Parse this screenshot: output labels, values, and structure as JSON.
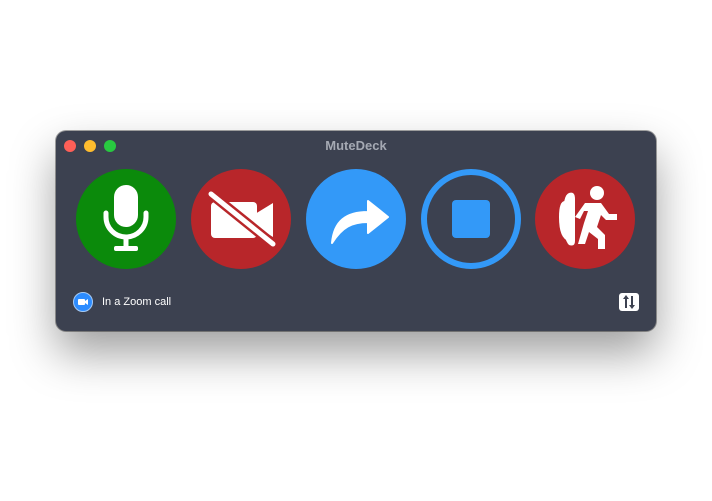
{
  "window": {
    "title": "MuteDeck"
  },
  "controls": [
    {
      "id": "microphone",
      "icon": "microphone-icon",
      "state": "unmuted",
      "color": "#0b8a0b"
    },
    {
      "id": "video",
      "icon": "video-off-icon",
      "state": "off",
      "color": "#b8262a"
    },
    {
      "id": "share",
      "icon": "share-arrow-icon",
      "state": "idle",
      "color": "#3399f8"
    },
    {
      "id": "record",
      "icon": "stop-record-icon",
      "state": "idle",
      "color": "#3399f8"
    },
    {
      "id": "leave",
      "icon": "leave-meeting-icon",
      "state": "idle",
      "color": "#b8262a"
    }
  ],
  "status": {
    "icon": "zoom-camera-icon",
    "text": "In a Zoom call"
  },
  "settings": {
    "icon": "settings-sliders-icon"
  },
  "colors": {
    "window_bg": "#3c4150",
    "green": "#0b8a0b",
    "red": "#b8262a",
    "blue": "#3399f8"
  }
}
